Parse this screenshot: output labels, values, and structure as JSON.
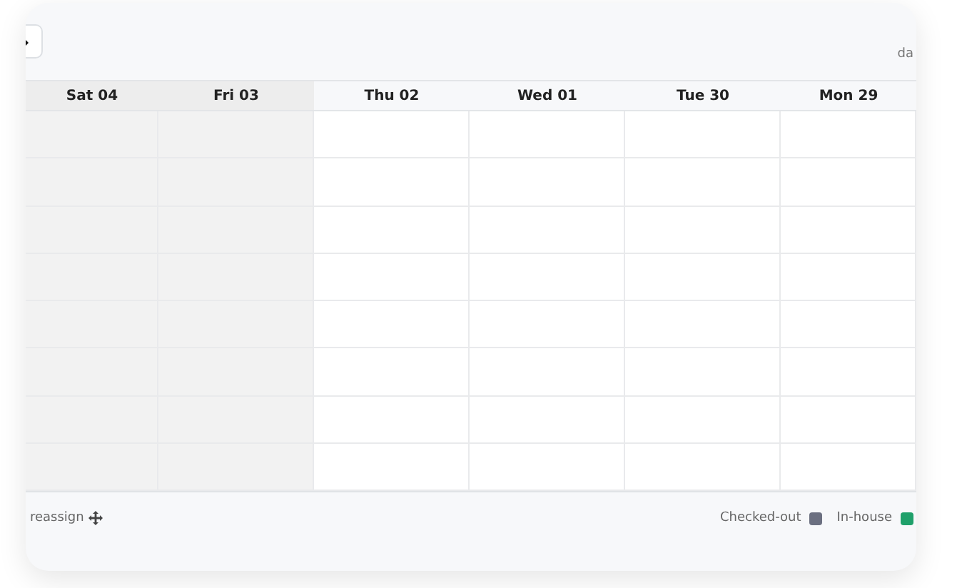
{
  "header": {
    "view_label": "da"
  },
  "days": [
    {
      "label": "Sat 04",
      "shaded": true
    },
    {
      "label": "Fri 03",
      "shaded": true
    },
    {
      "label": "Thu 02",
      "shaded": false
    },
    {
      "label": "Wed 01",
      "shaded": false
    },
    {
      "label": "Tue 30",
      "shaded": false
    },
    {
      "label": "Mon 29",
      "shaded": false
    }
  ],
  "footer": {
    "hint": "reassign",
    "legend": [
      {
        "label": "Checked-out",
        "color": "#6b6f80"
      },
      {
        "label": "In-house",
        "color": "#1fa06a"
      }
    ]
  }
}
